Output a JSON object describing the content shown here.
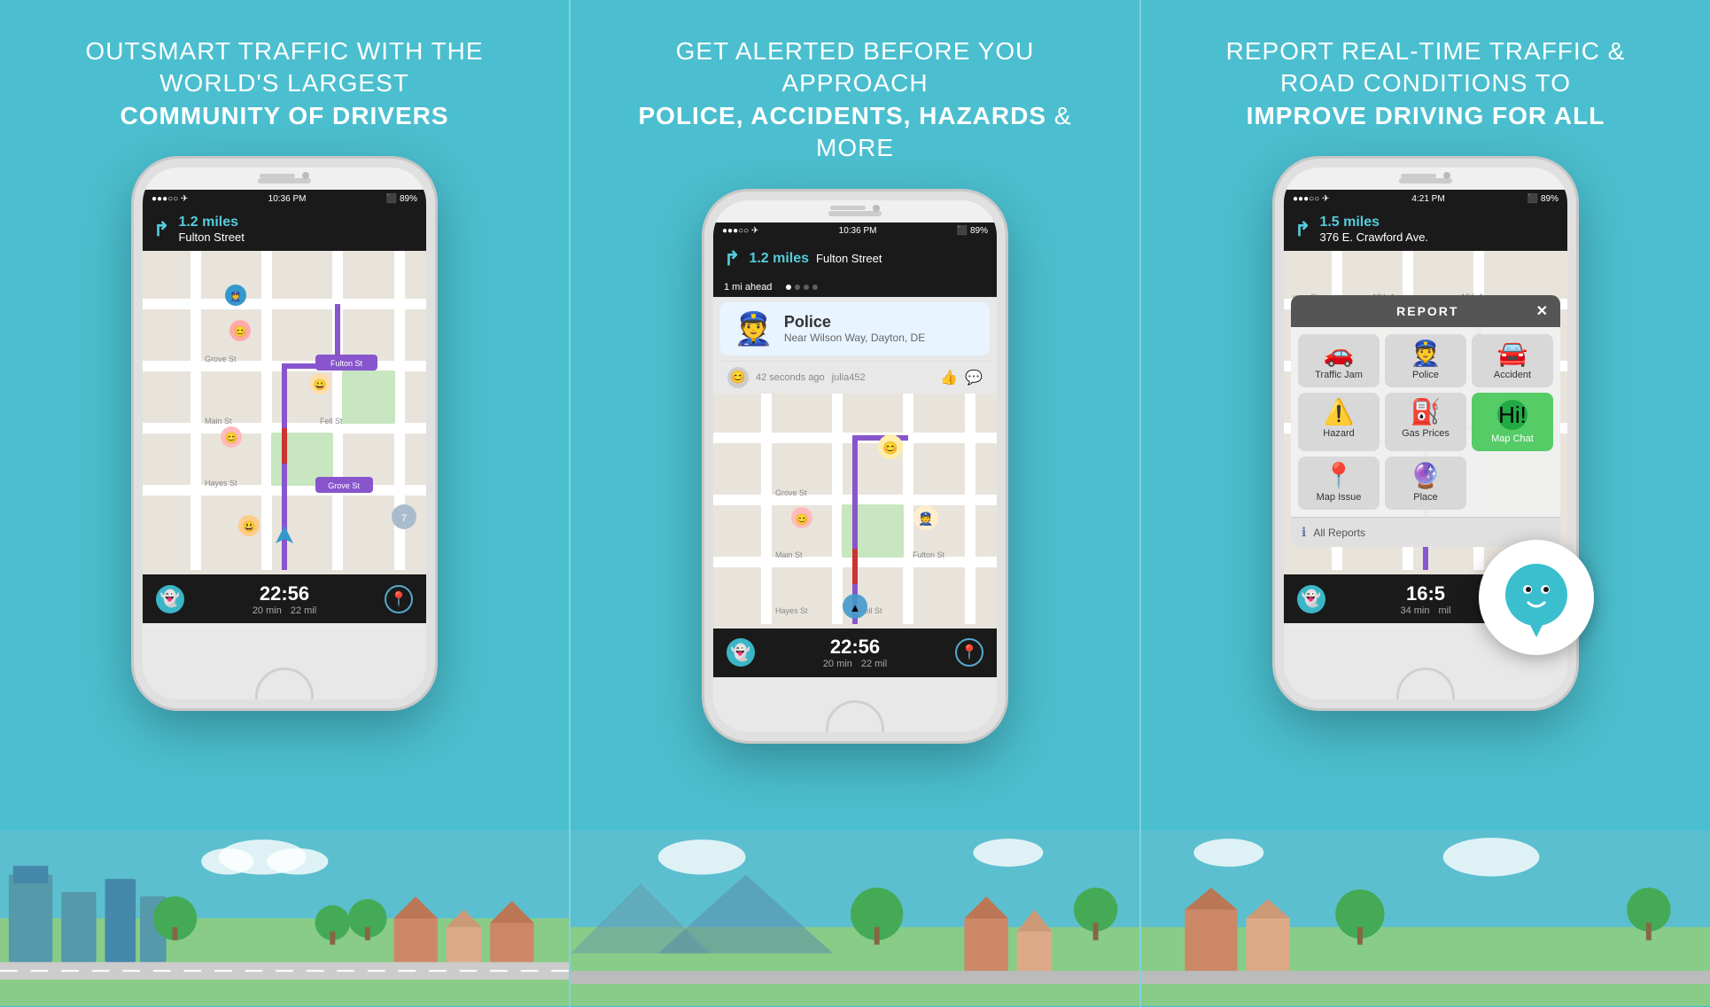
{
  "panel1": {
    "headline_light": "OUTSMART TRAFFIC WITH THE WORLD'S LARGEST",
    "headline_bold": "COMMUNITY OF DRIVERS",
    "phone": {
      "status": "10:36 PM",
      "battery": "89%",
      "distance": "1.2 miles",
      "street": "Fulton Street",
      "time": "22:56",
      "min": "20 min",
      "mil": "22 mil"
    }
  },
  "panel2": {
    "headline_light": "GET ALERTED BEFORE YOU APPROACH",
    "headline_bold": "POLICE, ACCIDENTS, HAZARDS",
    "headline_end": " & MORE",
    "phone": {
      "status": "10:36 PM",
      "battery": "89%",
      "distance": "1.2 miles",
      "street": "Fulton Street",
      "ahead_text": "1 mi ahead",
      "alert_type": "Police",
      "alert_location": "Near Wilson Way, Dayton, DE",
      "alert_user": "julia452",
      "alert_time": "42 seconds ago",
      "time": "22:56",
      "min": "20 min",
      "mil": "22 mil"
    }
  },
  "panel3": {
    "headline_light": "REPORT REAL-TIME TRAFFIC & ROAD CONDITIONS TO",
    "headline_bold": "IMPROVE DRIVING FOR ALL",
    "phone": {
      "status": "4:21 PM",
      "battery": "89%",
      "distance": "1.5 miles",
      "street": "376 E. Crawford Ave.",
      "time": "16:5",
      "min": "34 min",
      "mil": "mil",
      "report_title": "REPORT",
      "report_items": [
        {
          "label": "Traffic Jam",
          "icon": "🚗",
          "bg": "gray"
        },
        {
          "label": "Police",
          "icon": "👮",
          "bg": "gray"
        },
        {
          "label": "Accident",
          "icon": "🚘",
          "bg": "gray"
        },
        {
          "label": "Hazard",
          "icon": "⚠️",
          "bg": "gray"
        },
        {
          "label": "Gas Prices",
          "icon": "⛽",
          "bg": "gray"
        },
        {
          "label": "Map Chat",
          "icon": "💬",
          "bg": "green"
        },
        {
          "label": "Map Issue",
          "icon": "📍",
          "bg": "gray"
        },
        {
          "label": "Place",
          "icon": "🔮",
          "bg": "gray"
        }
      ],
      "all_reports": "All Reports"
    }
  }
}
